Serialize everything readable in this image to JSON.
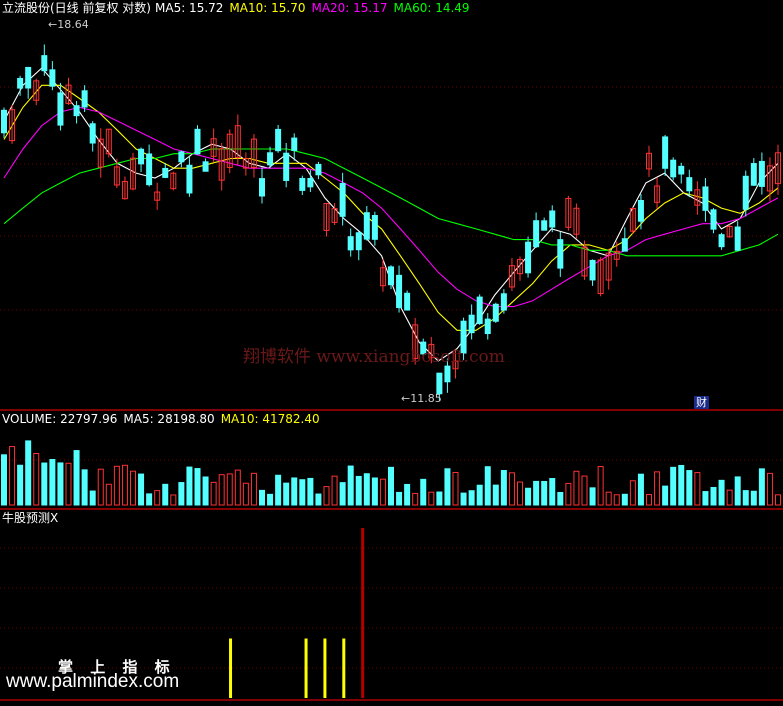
{
  "main_panel": {
    "stock_title": "立流股份(日线 前复权 对数)",
    "ma5_label": "MA5: 15.72",
    "ma10_label": "MA10: 15.70",
    "ma20_label": "MA20: 15.17",
    "ma60_label": "MA60: 14.49",
    "high_label": "18.64",
    "low_label": "11.85",
    "badge_label": "财",
    "watermark": "翔博软件 www.xiangbosoft.com"
  },
  "volume_panel": {
    "vol_label": "VOLUME: 22797.96",
    "ma5_label": "MA5: 28198.80",
    "ma10_label": "MA10: 41782.40"
  },
  "indicator_panel": {
    "title": "牛股预测X"
  },
  "footer": {
    "brand_cn": "掌 上 指 标",
    "url": "www.palmindex.com"
  },
  "colors": {
    "background": "#000000",
    "up_candle": "#ff3232",
    "down_candle": "#54ffff",
    "ma5": "#ffffff",
    "ma10": "#ffff00",
    "ma20": "#ff00ff",
    "ma60": "#00ff00",
    "grid": "#8b0000",
    "signal_yellow": "#ffff00",
    "signal_red": "#b40000"
  },
  "chart_data": {
    "type": "candlestick",
    "price_min": 11.85,
    "price_max": 18.64,
    "ma_lines": [
      {
        "name": "MA5",
        "color": "#ffffff",
        "values": [
          16.6,
          17.4,
          17.8,
          17.3,
          16.8,
          16.2,
          15.7,
          15.5,
          15.4,
          15.6,
          15.9,
          16.1,
          16.0,
          15.7,
          15.6,
          15.9,
          15.6,
          15.0,
          14.6,
          14.3,
          13.9,
          13.0,
          12.4,
          12.1,
          12.3,
          12.7,
          13.2,
          13.6,
          14.0,
          14.4,
          14.3,
          14.0,
          13.9,
          14.6,
          15.3,
          15.5,
          15.1,
          14.9,
          14.4,
          14.6,
          15.3,
          15.7
        ]
      },
      {
        "name": "MA10",
        "color": "#ffff00",
        "values": [
          16.2,
          16.9,
          17.4,
          17.4,
          17.1,
          16.8,
          16.4,
          16.0,
          15.8,
          15.6,
          15.6,
          15.7,
          15.8,
          15.8,
          15.7,
          15.7,
          15.7,
          15.4,
          15.1,
          14.7,
          14.4,
          13.9,
          13.4,
          12.9,
          12.6,
          12.6,
          12.8,
          13.1,
          13.4,
          13.8,
          14.1,
          14.1,
          14.0,
          14.2,
          14.6,
          14.9,
          15.1,
          15.0,
          14.8,
          14.7,
          14.9,
          15.2
        ]
      },
      {
        "name": "MA20",
        "color": "#ff00ff",
        "values": [
          15.4,
          16.0,
          16.5,
          16.8,
          16.9,
          16.8,
          16.6,
          16.4,
          16.2,
          16.0,
          15.9,
          15.8,
          15.7,
          15.6,
          15.6,
          15.6,
          15.6,
          15.5,
          15.3,
          15.1,
          14.8,
          14.4,
          14.0,
          13.6,
          13.3,
          13.1,
          13.0,
          13.0,
          13.1,
          13.3,
          13.5,
          13.7,
          13.9,
          14.0,
          14.2,
          14.3,
          14.4,
          14.5,
          14.5,
          14.6,
          14.8,
          15.0
        ]
      },
      {
        "name": "MA60",
        "color": "#00ff00",
        "values": [
          14.5,
          14.8,
          15.1,
          15.3,
          15.5,
          15.6,
          15.7,
          15.8,
          15.8,
          15.9,
          15.9,
          16.0,
          16.0,
          16.0,
          16.0,
          16.0,
          15.9,
          15.8,
          15.6,
          15.4,
          15.2,
          15.0,
          14.8,
          14.6,
          14.5,
          14.4,
          14.3,
          14.2,
          14.2,
          14.1,
          14.1,
          14.0,
          14.0,
          13.9,
          13.9,
          13.9,
          13.9,
          13.9,
          13.9,
          14.0,
          14.1,
          14.3
        ]
      }
    ],
    "indicator_signals": [
      {
        "bar_index": 12,
        "color": "#ffff00",
        "strength": 0.35
      },
      {
        "bar_index": 16,
        "color": "#ffff00",
        "strength": 0.35
      },
      {
        "bar_index": 17,
        "color": "#ffff00",
        "strength": 0.35
      },
      {
        "bar_index": 18,
        "color": "#ffff00",
        "strength": 0.35
      },
      {
        "bar_index": 19,
        "color": "#b40000",
        "strength": 1.0
      }
    ]
  }
}
